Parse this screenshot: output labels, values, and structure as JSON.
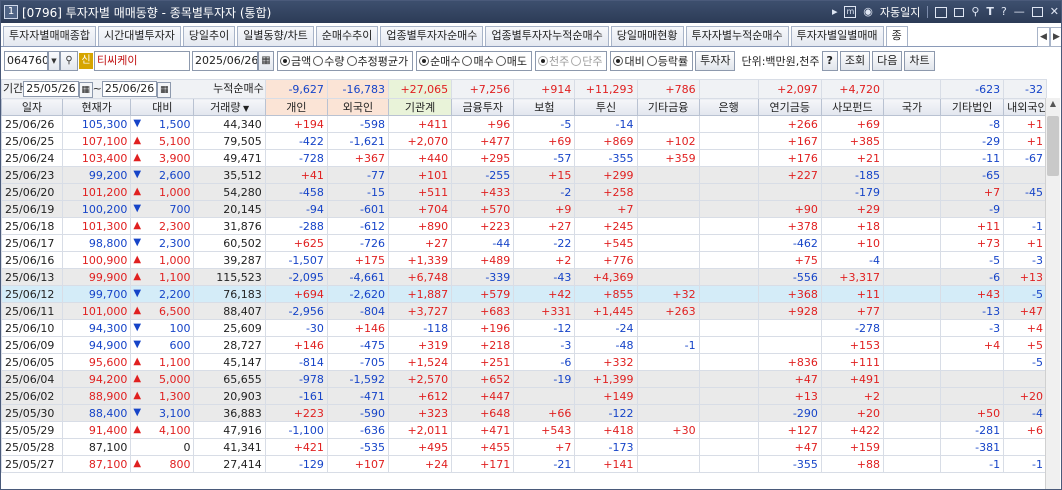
{
  "window": {
    "number": "1",
    "title": "[0796] 투자자별 매매동향 - 종목별투자자 (통합)",
    "auto_daily_label": "자동일지",
    "icons": [
      "play-icon",
      "memo-icon",
      "clock-icon",
      "layout-icon",
      "copy-icon",
      "pin-icon",
      "font-icon",
      "help-icon",
      "minimize-icon",
      "maximize-icon",
      "close-icon"
    ]
  },
  "tabs": [
    {
      "label": "투자자별매매종합",
      "active": false
    },
    {
      "label": "시간대별투자자",
      "active": false
    },
    {
      "label": "당일추이",
      "active": false
    },
    {
      "label": "일별동향/차트",
      "active": false
    },
    {
      "label": "순매수추이",
      "active": false
    },
    {
      "label": "업종별투자자순매수",
      "active": false
    },
    {
      "label": "업종별투자자누적순매수",
      "active": false
    },
    {
      "label": "당일매매현황",
      "active": false
    },
    {
      "label": "투자자별누적순매수",
      "active": false
    },
    {
      "label": "투자자별일별매매",
      "active": false
    },
    {
      "label": "종",
      "active": true
    }
  ],
  "toolbar": {
    "stock_code": "064760",
    "sin_badge": "신",
    "stock_name": "티씨케이",
    "date": "2025/06/26",
    "radios_value": [
      {
        "label": "금액",
        "on": true
      },
      {
        "label": "수량",
        "on": false
      },
      {
        "label": "추정평균가",
        "on": false
      }
    ],
    "radios_side": [
      {
        "label": "순매수",
        "on": true
      },
      {
        "label": "매수",
        "on": false
      },
      {
        "label": "매도",
        "on": false
      }
    ],
    "radios_unit": [
      {
        "label": "천주",
        "on": true,
        "disabled": true
      },
      {
        "label": "단주",
        "on": false,
        "disabled": true
      }
    ],
    "radios_compare": [
      {
        "label": "대비",
        "on": true
      },
      {
        "label": "등락률",
        "on": false
      }
    ],
    "investor_button": "투자자",
    "unit_label": "단위:백만원,천주",
    "help_button": "?",
    "search_button": "조회",
    "next_button": "다음",
    "chart_button": "차트"
  },
  "period": {
    "label": "기간",
    "from": "25/05/26",
    "sep": "~",
    "to": "25/06/26",
    "cum_label": "누적순매수",
    "sums": [
      "-9,627",
      "-16,783",
      "+27,065",
      "+7,256",
      "+914",
      "+11,293",
      "+786",
      "",
      "+2,097",
      "+4,720",
      "",
      "-623",
      "-32"
    ]
  },
  "columns": [
    "일자",
    "현재가",
    "대비",
    "거래량",
    "개인",
    "외국인",
    "기관계",
    "금융투자",
    "보험",
    "투신",
    "기타금융",
    "은행",
    "연기금등",
    "사모펀드",
    "국가",
    "기타법인",
    "내외국인"
  ],
  "rows": [
    {
      "date": "25/06/26",
      "price": "105,300",
      "dir": "dn",
      "chg": "1,500",
      "vol": "44,340",
      "v": [
        "+194",
        "-598",
        "+411",
        "+96",
        "-5",
        "-14",
        "",
        "",
        "+266",
        "+69",
        "",
        "-8",
        "+1"
      ],
      "style": ""
    },
    {
      "date": "25/06/25",
      "price": "107,100",
      "dir": "up",
      "chg": "5,100",
      "vol": "79,505",
      "v": [
        "-422",
        "-1,621",
        "+2,070",
        "+477",
        "+69",
        "+869",
        "+102",
        "",
        "+167",
        "+385",
        "",
        "-29",
        "+1"
      ],
      "style": ""
    },
    {
      "date": "25/06/24",
      "price": "103,400",
      "dir": "up",
      "chg": "3,900",
      "vol": "49,471",
      "v": [
        "-728",
        "+367",
        "+440",
        "+295",
        "-57",
        "-355",
        "+359",
        "",
        "+176",
        "+21",
        "",
        "-11",
        "-67"
      ],
      "style": ""
    },
    {
      "date": "25/06/23",
      "price": "99,200",
      "dir": "dn",
      "chg": "2,600",
      "vol": "35,512",
      "v": [
        "+41",
        "-77",
        "+101",
        "-255",
        "+15",
        "+299",
        "",
        "",
        "+227",
        "-185",
        "",
        "-65",
        ""
      ],
      "style": "g"
    },
    {
      "date": "25/06/20",
      "price": "101,200",
      "dir": "up",
      "chg": "1,000",
      "vol": "54,280",
      "v": [
        "-458",
        "-15",
        "+511",
        "+433",
        "-2",
        "+258",
        "",
        "",
        "",
        "-179",
        "",
        "+7",
        "-45"
      ],
      "style": "g"
    },
    {
      "date": "25/06/19",
      "price": "100,200",
      "dir": "dn",
      "chg": "700",
      "vol": "20,145",
      "v": [
        "-94",
        "-601",
        "+704",
        "+570",
        "+9",
        "+7",
        "",
        "",
        "+90",
        "+29",
        "",
        "-9",
        ""
      ],
      "style": "g"
    },
    {
      "date": "25/06/18",
      "price": "101,300",
      "dir": "up",
      "chg": "2,300",
      "vol": "31,876",
      "v": [
        "-288",
        "-612",
        "+890",
        "+223",
        "+27",
        "+245",
        "",
        "",
        "+378",
        "+18",
        "",
        "+11",
        "-1"
      ],
      "style": ""
    },
    {
      "date": "25/06/17",
      "price": "98,800",
      "dir": "dn",
      "chg": "2,300",
      "vol": "60,502",
      "v": [
        "+625",
        "-726",
        "+27",
        "-44",
        "-22",
        "+545",
        "",
        "",
        "-462",
        "+10",
        "",
        "+73",
        "+1"
      ],
      "style": ""
    },
    {
      "date": "25/06/16",
      "price": "100,900",
      "dir": "up",
      "chg": "1,000",
      "vol": "39,287",
      "v": [
        "-1,507",
        "+175",
        "+1,339",
        "+489",
        "+2",
        "+776",
        "",
        "",
        "+75",
        "-4",
        "",
        "-5",
        "-3"
      ],
      "style": ""
    },
    {
      "date": "25/06/13",
      "price": "99,900",
      "dir": "up",
      "chg": "1,100",
      "vol": "115,523",
      "v": [
        "-2,095",
        "-4,661",
        "+6,748",
        "-339",
        "-43",
        "+4,369",
        "",
        "",
        "-556",
        "+3,317",
        "",
        "-6",
        "+13"
      ],
      "style": "g"
    },
    {
      "date": "25/06/12",
      "price": "99,700",
      "dir": "dn",
      "chg": "2,200",
      "vol": "76,183",
      "v": [
        "+694",
        "-2,620",
        "+1,887",
        "+579",
        "+42",
        "+855",
        "+32",
        "",
        "+368",
        "+11",
        "",
        "+43",
        "-5"
      ],
      "style": "sel"
    },
    {
      "date": "25/06/11",
      "price": "101,000",
      "dir": "up",
      "chg": "6,500",
      "vol": "88,407",
      "v": [
        "-2,956",
        "-804",
        "+3,727",
        "+683",
        "+331",
        "+1,445",
        "+263",
        "",
        "+928",
        "+77",
        "",
        "-13",
        "+47"
      ],
      "style": "g"
    },
    {
      "date": "25/06/10",
      "price": "94,300",
      "dir": "dn",
      "chg": "100",
      "vol": "25,609",
      "v": [
        "-30",
        "+146",
        "-118",
        "+196",
        "-12",
        "-24",
        "",
        "",
        "",
        "-278",
        "",
        "-3",
        "+4"
      ],
      "style": ""
    },
    {
      "date": "25/06/09",
      "price": "94,900",
      "dir": "dn",
      "chg": "600",
      "vol": "28,727",
      "v": [
        "+146",
        "-475",
        "+319",
        "+218",
        "-3",
        "-48",
        "-1",
        "",
        "",
        "+153",
        "",
        "+4",
        "+5"
      ],
      "style": ""
    },
    {
      "date": "25/06/05",
      "price": "95,600",
      "dir": "up",
      "chg": "1,100",
      "vol": "45,147",
      "v": [
        "-814",
        "-705",
        "+1,524",
        "+251",
        "-6",
        "+332",
        "",
        "",
        "+836",
        "+111",
        "",
        "",
        "-5"
      ],
      "style": ""
    },
    {
      "date": "25/06/04",
      "price": "94,200",
      "dir": "up",
      "chg": "5,000",
      "vol": "65,655",
      "v": [
        "-978",
        "-1,592",
        "+2,570",
        "+652",
        "-19",
        "+1,399",
        "",
        "",
        "+47",
        "+491",
        "",
        "",
        ""
      ],
      "style": "g"
    },
    {
      "date": "25/06/02",
      "price": "88,900",
      "dir": "up",
      "chg": "1,300",
      "vol": "20,903",
      "v": [
        "-161",
        "-471",
        "+612",
        "+447",
        "",
        "+149",
        "",
        "",
        "+13",
        "+2",
        "",
        "",
        "+20"
      ],
      "style": "g"
    },
    {
      "date": "25/05/30",
      "price": "88,400",
      "dir": "dn",
      "chg": "3,100",
      "vol": "36,883",
      "v": [
        "+223",
        "-590",
        "+323",
        "+648",
        "+66",
        "-122",
        "",
        "",
        "-290",
        "+20",
        "",
        "+50",
        "-4"
      ],
      "style": "g"
    },
    {
      "date": "25/05/29",
      "price": "91,400",
      "dir": "up",
      "chg": "4,100",
      "vol": "47,916",
      "v": [
        "-1,100",
        "-636",
        "+2,011",
        "+471",
        "+543",
        "+418",
        "+30",
        "",
        "+127",
        "+422",
        "",
        "-281",
        "+6"
      ],
      "style": ""
    },
    {
      "date": "25/05/28",
      "price": "87,100",
      "dir": "",
      "chg": "0",
      "vol": "41,341",
      "v": [
        "+421",
        "-535",
        "+495",
        "+455",
        "+7",
        "-173",
        "",
        "",
        "+47",
        "+159",
        "",
        "-381",
        ""
      ],
      "style": ""
    },
    {
      "date": "25/05/27",
      "price": "87,100",
      "dir": "up",
      "chg": "800",
      "vol": "27,414",
      "v": [
        "-129",
        "+107",
        "+24",
        "+171",
        "-21",
        "+141",
        "",
        "",
        "-355",
        "+88",
        "",
        "-1",
        "-1"
      ],
      "style": ""
    }
  ],
  "colors": {
    "up": "#e02020",
    "down": "#1644c8",
    "titlebar": "#34466a",
    "selected_row": "#d4ecf8"
  }
}
